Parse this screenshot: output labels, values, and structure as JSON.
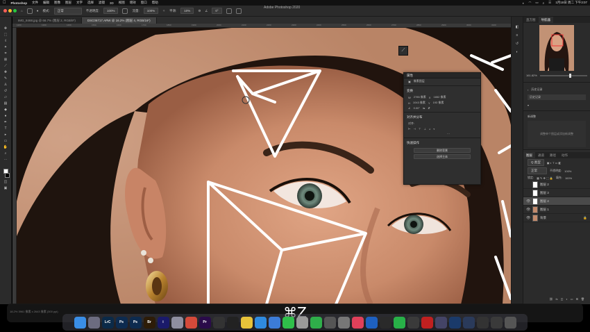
{
  "menubar": {
    "app_name": "Photoshop",
    "items": [
      "文件",
      "编辑",
      "图像",
      "图层",
      "文字",
      "选择",
      "滤镜",
      "3D",
      "视图",
      "增效",
      "窗口",
      "帮助"
    ],
    "clock": "1月18日 周二 下午3:07"
  },
  "window": {
    "title": "Adobe Photoshop 2020"
  },
  "options_bar": {
    "mode_label": "模式:",
    "mode_value": "正常",
    "opacity_label": "不透明度:",
    "opacity_value": "100%",
    "flow_label": "流量:",
    "flow_value": "100%",
    "smooth_label": "平滑:",
    "smooth_value": "10%",
    "angle_value": "0°"
  },
  "tabs": [
    {
      "label": "IMG_8468.jpg @ 66.7% (图层 2, RGB/8*)",
      "active": false
    },
    {
      "label": "DSC06717.ARW @ 16.2% (图层 4, RGB/16*)",
      "active": true
    }
  ],
  "ruler": {
    "ticks": [
      "1200",
      "1300",
      "1400",
      "1500",
      "1600",
      "1700",
      "1800",
      "1900",
      "2000",
      "2100",
      "2200",
      "2300",
      "2400",
      "2500",
      "2600",
      "2700",
      "2800",
      "2900",
      "3000",
      "3100"
    ]
  },
  "properties": {
    "title": "属性",
    "subtitle": "像素图层",
    "transform_title": "变换",
    "w_label": "W",
    "w_value": "2785 像素",
    "x_label": "X",
    "x_value": "1652 像素",
    "h_label": "H",
    "h_value": "1043 像素",
    "y_label": "Y",
    "y_value": "193 像素",
    "angle_value": "0.00°",
    "align_title": "对齐并分布",
    "align_sub": "对齐:",
    "quick_title": "快速操作",
    "btn_remove_bg": "删除背景",
    "btn_select_subject": "选择主体"
  },
  "right_panel": {
    "tab_navigator": "导航器",
    "tab_histogram": "直方图",
    "zoom_value": "161.82%",
    "tab_history": "历史记录",
    "history_text": "历史记录",
    "adjust_title": "新调整",
    "adjust_hint": "调整单个图层或添加新调整",
    "layers_tabs": [
      "图层",
      "通道",
      "路径",
      "动作"
    ],
    "kind_label": "Q 类型",
    "blend_mode": "正常",
    "opacity_label": "不透明度:",
    "opacity_value": "100%",
    "lock_label": "锁定:",
    "fill_label": "填充:",
    "fill_value": "100%",
    "layers": [
      {
        "name": "图层 2",
        "selected": false,
        "visible": false
      },
      {
        "name": "图层 3",
        "selected": false,
        "visible": false
      },
      {
        "name": "图层 4",
        "selected": true,
        "visible": true
      },
      {
        "name": "图层 1",
        "selected": false,
        "visible": true
      },
      {
        "name": "背景",
        "selected": false,
        "visible": true
      }
    ]
  },
  "status": {
    "text": "18.2%  3961 像素 x 2643 像素 (300 ppi)"
  },
  "shortcut_overlay": "⌘Z",
  "dock": {
    "icons": [
      {
        "name": "finder",
        "label": "",
        "color": "#3a8ee6"
      },
      {
        "name": "launchpad",
        "label": "",
        "color": "#6c6c80"
      },
      {
        "name": "lightroom-classic",
        "label": "LrC",
        "color": "#0b2a48"
      },
      {
        "name": "photoshop",
        "label": "Ps",
        "color": "#0d2b4f"
      },
      {
        "name": "photoshop-2",
        "label": "Ps",
        "color": "#0d2b4f"
      },
      {
        "name": "bridge",
        "label": "Br",
        "color": "#2d1c08"
      },
      {
        "name": "instagram-app",
        "label": "i",
        "color": "#1a1a6a"
      },
      {
        "name": "app-a",
        "label": "",
        "color": "#8f8fa0"
      },
      {
        "name": "chrome",
        "label": "",
        "color": "#d44a3a"
      },
      {
        "name": "premiere",
        "label": "Pr",
        "color": "#2a0b4a"
      },
      {
        "name": "capture",
        "label": "",
        "color": "#333"
      },
      {
        "name": "final-cut",
        "label": "",
        "color": "#222"
      },
      {
        "name": "notes",
        "label": "",
        "color": "#e8c33a"
      },
      {
        "name": "safari",
        "label": "",
        "color": "#2f8be0"
      },
      {
        "name": "mail",
        "label": "",
        "color": "#3c7cd8"
      },
      {
        "name": "messages",
        "label": "",
        "color": "#2fbf4a"
      },
      {
        "name": "app-b",
        "label": "",
        "color": "#9a9a9a"
      },
      {
        "name": "wechat",
        "label": "",
        "color": "#2fae4a"
      },
      {
        "name": "app-c",
        "label": "",
        "color": "#555"
      },
      {
        "name": "system-prefs",
        "label": "",
        "color": "#777"
      },
      {
        "name": "music",
        "label": "",
        "color": "#e0405a"
      },
      {
        "name": "app-d",
        "label": "",
        "color": "#1e60c0"
      },
      {
        "name": "app-e",
        "label": "",
        "color": "#2a2a2a"
      },
      {
        "name": "facetime",
        "label": "",
        "color": "#28b048"
      },
      {
        "name": "app-f",
        "label": "",
        "color": "#3a3a3a"
      },
      {
        "name": "app-g",
        "label": "",
        "color": "#c02020"
      },
      {
        "name": "app-h",
        "label": "",
        "color": "#446"
      },
      {
        "name": "app-i",
        "label": "",
        "color": "#1a3a6a"
      },
      {
        "name": "app-j",
        "label": "",
        "color": "#2a3a5a"
      },
      {
        "name": "app-k",
        "label": "",
        "color": "#333"
      },
      {
        "name": "app-l",
        "label": "",
        "color": "#3a3a3a"
      },
      {
        "name": "trash",
        "label": "",
        "color": "#555"
      }
    ]
  }
}
